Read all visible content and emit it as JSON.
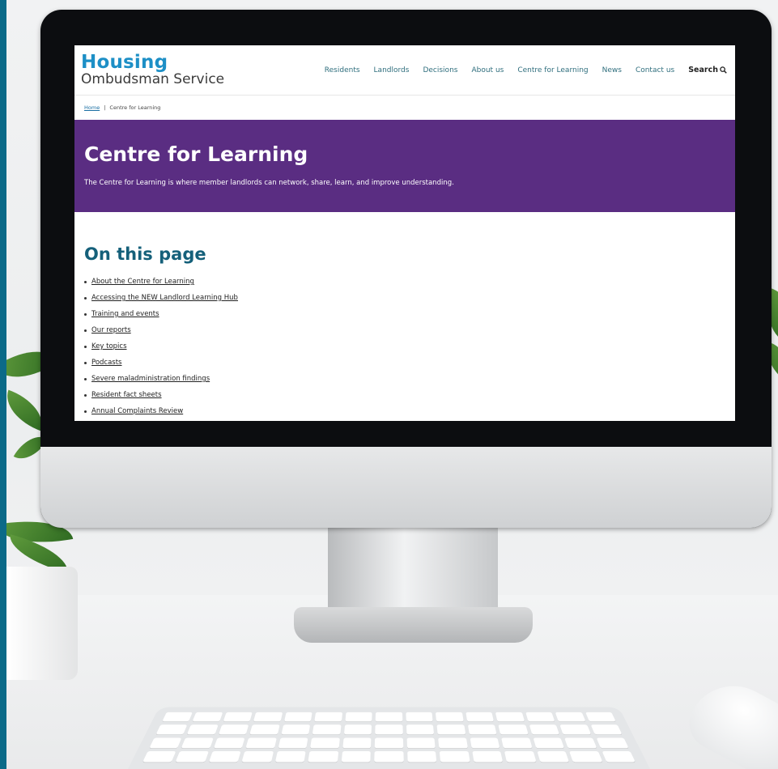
{
  "site": {
    "logo": {
      "line1": "Housing",
      "line2": "Ombudsman Service"
    },
    "nav": [
      "Residents",
      "Landlords",
      "Decisions",
      "About us",
      "Centre for Learning",
      "News",
      "Contact us"
    ],
    "search_label": "Search",
    "search_icon": "search-icon"
  },
  "breadcrumb": {
    "home": "Home",
    "separator": "|",
    "current": "Centre for Learning"
  },
  "hero": {
    "title": "Centre for Learning",
    "description": "The Centre for Learning is where member landlords can network, share, learn, and improve understanding."
  },
  "content": {
    "heading": "On this page",
    "links": [
      "About the Centre for Learning",
      "Accessing the NEW Landlord Learning Hub",
      "Training and events",
      "Our reports",
      "Key topics",
      "Podcasts",
      "Severe maladministration findings",
      "Resident fact sheets",
      "Annual Complaints Review"
    ]
  },
  "colors": {
    "hero_background": "#5a2d82",
    "logo_blue": "#1d8fc6",
    "heading_teal": "#15607a",
    "page_border": "#0b6a88"
  }
}
